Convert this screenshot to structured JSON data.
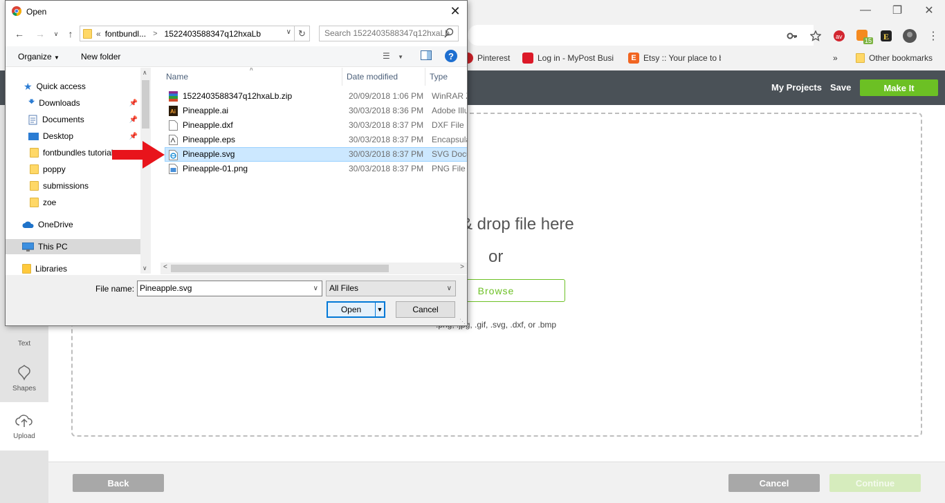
{
  "browser": {
    "bookmarks": [
      {
        "label": "Pinterest",
        "icon": "pinterest-icon",
        "color": "#cb2027"
      },
      {
        "label": "Log in - MyPost Busi",
        "icon": "auspost-icon",
        "color": "#dc1928"
      },
      {
        "label": "Etsy :: Your place to b",
        "icon": "etsy-icon",
        "color": "#f16521"
      }
    ],
    "more_bookmarks": "»",
    "other_bookmarks": "Other bookmarks",
    "extension_badge": "15"
  },
  "app": {
    "header": {
      "my_projects": "My Projects",
      "save": "Save",
      "make_it": "Make It"
    },
    "rail": [
      {
        "label": "Text",
        "icon": "text-icon"
      },
      {
        "label": "Shapes",
        "icon": "shapes-icon"
      },
      {
        "label": "Upload",
        "icon": "upload-icon"
      }
    ],
    "dropzone": {
      "drag_text": "& drop file here",
      "or_text": "or",
      "browse": "Browse",
      "formats": ".png, .jpg, .gif, .svg, .dxf, or .bmp"
    },
    "footer": {
      "back": "Back",
      "cancel": "Cancel",
      "continue": "Continue"
    },
    "colors": {
      "accent": "#6cc024",
      "header": "#4a5157",
      "button_gray": "#a8a8a8",
      "disabled_green": "#d6ecbd"
    }
  },
  "dialog": {
    "title": "Open",
    "address": {
      "overflow": "«",
      "crumb1": "fontbundl...",
      "sep": ">",
      "crumb2": "1522403588347q12hxaLb"
    },
    "search_placeholder": "Search 1522403588347q12hxaLb",
    "toolbar": {
      "organize": "Organize",
      "new_folder": "New folder"
    },
    "nav": [
      {
        "label": "Quick access",
        "icon": "star-icon",
        "pinned": false
      },
      {
        "label": "Downloads",
        "icon": "downloads-icon",
        "pinned": true
      },
      {
        "label": "Documents",
        "icon": "documents-icon",
        "pinned": true
      },
      {
        "label": "Desktop",
        "icon": "desktop-icon",
        "pinned": true
      },
      {
        "label": "fontbundles tutorials",
        "icon": "folder-icon",
        "pinned": false
      },
      {
        "label": "poppy",
        "icon": "folder-icon",
        "pinned": false
      },
      {
        "label": "submissions",
        "icon": "folder-icon",
        "pinned": false
      },
      {
        "label": "zoe",
        "icon": "folder-icon",
        "pinned": false
      },
      {
        "label": "OneDrive",
        "icon": "onedrive-icon",
        "pinned": false
      },
      {
        "label": "This PC",
        "icon": "pc-icon",
        "pinned": false
      },
      {
        "label": "Libraries",
        "icon": "libraries-icon",
        "pinned": false
      }
    ],
    "columns": {
      "name": "Name",
      "date": "Date modified",
      "type": "Type"
    },
    "files": [
      {
        "name": "1522403588347q12hxaLb.zip",
        "date": "20/09/2018 1:06 PM",
        "type": "WinRAR Z",
        "icon": "winrar-icon"
      },
      {
        "name": "Pineapple.ai",
        "date": "30/03/2018 8:36 PM",
        "type": "Adobe Illu",
        "icon": "illustrator-icon"
      },
      {
        "name": "Pineapple.dxf",
        "date": "30/03/2018 8:37 PM",
        "type": "DXF File",
        "icon": "blank-file-icon"
      },
      {
        "name": "Pineapple.eps",
        "date": "30/03/2018 8:37 PM",
        "type": "Encapsulat",
        "icon": "eps-file-icon"
      },
      {
        "name": "Pineapple.svg",
        "date": "30/03/2018 8:37 PM",
        "type": "SVG Docu",
        "icon": "ie-file-icon",
        "selected": true
      },
      {
        "name": "Pineapple-01.png",
        "date": "30/03/2018 8:37 PM",
        "type": "PNG File",
        "icon": "image-file-icon"
      }
    ],
    "file_name_label": "File name:",
    "file_name_value": "Pineapple.svg",
    "file_type": "All Files",
    "open": "Open",
    "cancel": "Cancel"
  }
}
